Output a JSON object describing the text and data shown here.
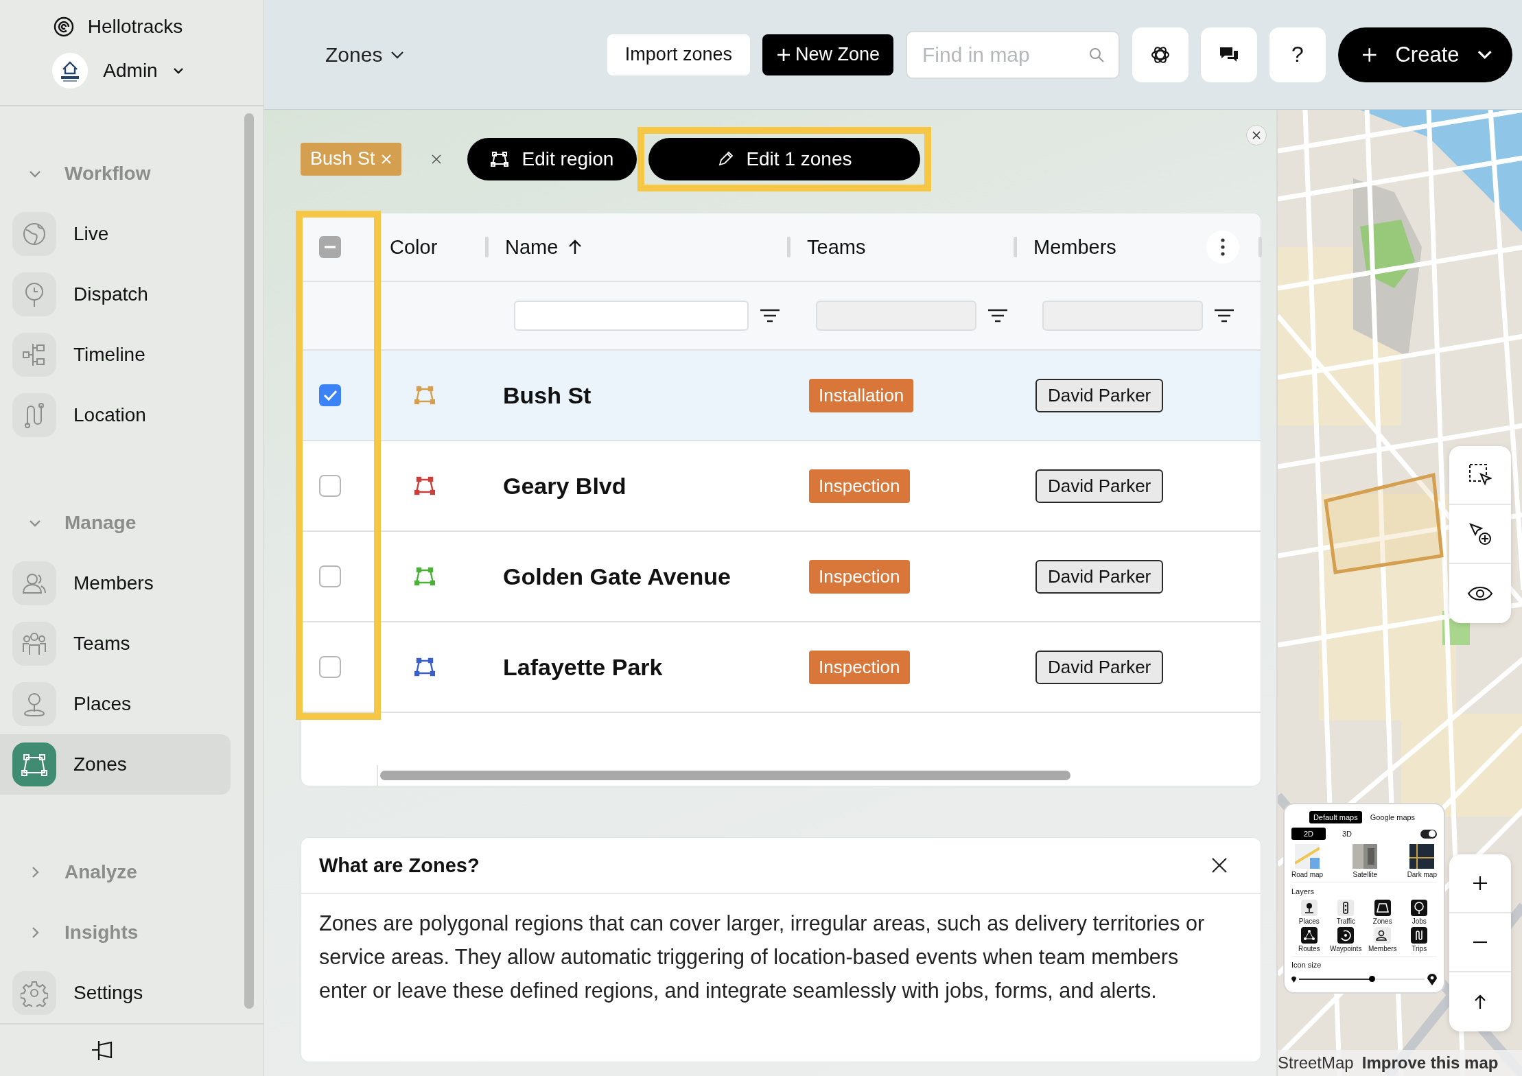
{
  "brand": {
    "name": "Hellotracks"
  },
  "account": {
    "name": "Admin"
  },
  "sidebar": {
    "groups": [
      {
        "title": "Workflow",
        "expanded": true,
        "items": [
          {
            "label": "Live",
            "selected": false
          },
          {
            "label": "Dispatch",
            "selected": false
          },
          {
            "label": "Timeline",
            "selected": false
          },
          {
            "label": "Location",
            "selected": false
          }
        ]
      },
      {
        "title": "Manage",
        "expanded": true,
        "items": [
          {
            "label": "Members",
            "selected": false
          },
          {
            "label": "Teams",
            "selected": false
          },
          {
            "label": "Places",
            "selected": false
          },
          {
            "label": "Zones",
            "selected": true
          }
        ]
      },
      {
        "title": "Analyze",
        "expanded": false
      },
      {
        "title": "Insights",
        "expanded": false
      }
    ],
    "settings": {
      "label": "Settings",
      "selected": false
    }
  },
  "topbar": {
    "page_title": "Zones",
    "import_button": "Import zones",
    "new_button": "New Zone",
    "search": {
      "placeholder": "Find in map"
    },
    "help_button": "?",
    "create_button": "Create"
  },
  "toolbar": {
    "chip": {
      "label": "Bush St"
    },
    "edit_region": "Edit region",
    "edit_zones": {
      "label": "Edit 1 zones",
      "highlighted": true
    }
  },
  "table": {
    "all_selected": false,
    "some_selected": true,
    "select_column_highlighted": true,
    "columns": [
      {
        "label": "Color",
        "sorted": false
      },
      {
        "label": "Name",
        "sorted": true
      },
      {
        "label": "Teams",
        "sorted": false
      },
      {
        "label": "Members",
        "sorted": false
      }
    ],
    "filters": [
      {
        "disabled": false
      },
      {
        "disabled": true
      },
      {
        "disabled": true
      }
    ],
    "rows": [
      {
        "checked": true,
        "selected": true,
        "color": "#d4a04f",
        "name": "Bush St",
        "team": "Installation",
        "member": "David Parker"
      },
      {
        "checked": false,
        "selected": false,
        "color": "#c9403a",
        "name": "Geary Blvd",
        "team": "Inspection",
        "member": "David Parker"
      },
      {
        "checked": false,
        "selected": false,
        "color": "#4caf3a",
        "name": "Golden Gate Avenue",
        "team": "Inspection",
        "member": "David Parker"
      },
      {
        "checked": false,
        "selected": false,
        "color": "#3a5fc9",
        "name": "Lafayette Park",
        "team": "Inspection",
        "member": "David Parker"
      }
    ]
  },
  "info": {
    "title": "What are Zones?",
    "text": "Zones are polygonal regions that can cover larger, irregular areas, such as delivery territories or service areas. They allow automatic triggering of location-based events when team members enter or leave these defined regions, and integrate seamlessly with jobs, forms, and alerts."
  },
  "map": {
    "kind": "picture",
    "layer_panel": {
      "map_tabs": [
        {
          "label": "Default maps",
          "selected": true
        },
        {
          "label": "Google maps",
          "selected": false
        }
      ],
      "view_tabs": [
        {
          "label": "2D",
          "selected": true
        },
        {
          "label": "3D",
          "selected": false
        }
      ],
      "toggle_on": true,
      "styles": [
        "Road map",
        "Satellite",
        "Dark map"
      ],
      "layers_title": "Layers",
      "layers": [
        {
          "label": "Places",
          "on": false
        },
        {
          "label": "Traffic",
          "on": false
        },
        {
          "label": "Zones",
          "on": true
        },
        {
          "label": "Jobs",
          "on": true
        },
        {
          "label": "Routes",
          "on": true
        },
        {
          "label": "Waypoints",
          "on": true
        },
        {
          "label": "Members",
          "on": false
        },
        {
          "label": "Trips",
          "on": true
        }
      ],
      "icon_size_title": "Icon size",
      "icon_size": {
        "level": 0.58
      }
    },
    "attribution": {
      "text": "StreetMap",
      "link": "Improve this map"
    }
  }
}
